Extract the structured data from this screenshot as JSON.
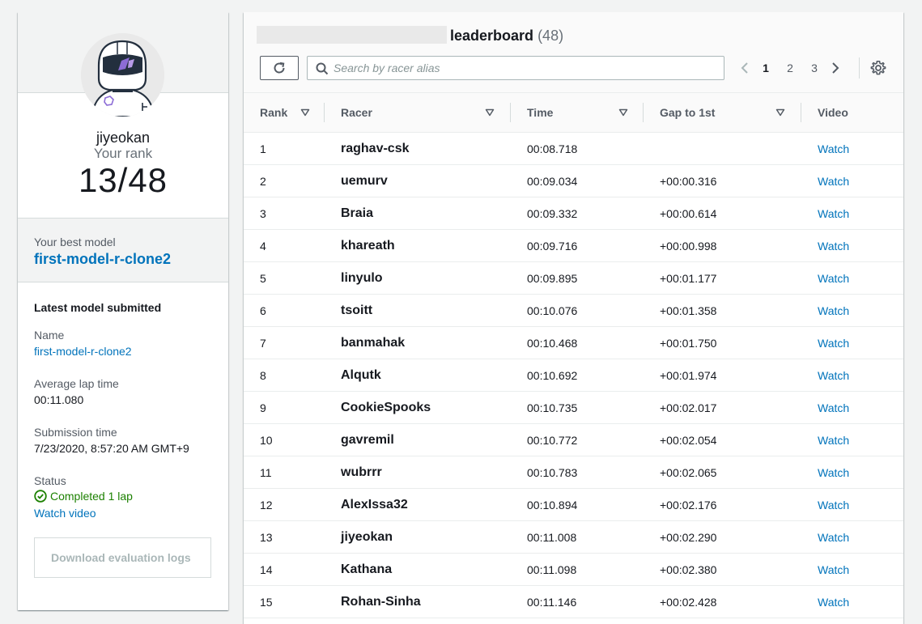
{
  "profile": {
    "username": "jiyeokan",
    "rank_label": "Your rank",
    "rank_value": "13/48",
    "best_model_label": "Your best model",
    "best_model_name": "first-model-r-clone2"
  },
  "latest": {
    "title": "Latest model submitted",
    "name_label": "Name",
    "name_value": "first-model-r-clone2",
    "avg_label": "Average lap time",
    "avg_value": "00:11.080",
    "submission_label": "Submission time",
    "submission_value": "7/23/2020, 8:57:20 AM GMT+9",
    "status_label": "Status",
    "status_value": "Completed 1 lap",
    "watch_video": "Watch video",
    "download_button": "Download evaluation logs"
  },
  "leaderboard": {
    "title": "leaderboard",
    "count": "(48)",
    "search_placeholder": "Search by racer alias",
    "pages": [
      "1",
      "2",
      "3"
    ],
    "active_page": "1",
    "columns": [
      "Rank",
      "Racer",
      "Time",
      "Gap to 1st",
      "Video"
    ],
    "rows": [
      {
        "rank": "1",
        "racer": "raghav-csk",
        "time": "00:08.718",
        "gap": "",
        "video": "Watch"
      },
      {
        "rank": "2",
        "racer": "uemurv",
        "time": "00:09.034",
        "gap": "+00:00.316",
        "video": "Watch"
      },
      {
        "rank": "3",
        "racer": "Braia",
        "time": "00:09.332",
        "gap": "+00:00.614",
        "video": "Watch"
      },
      {
        "rank": "4",
        "racer": "khareath",
        "time": "00:09.716",
        "gap": "+00:00.998",
        "video": "Watch"
      },
      {
        "rank": "5",
        "racer": "linyulo",
        "time": "00:09.895",
        "gap": "+00:01.177",
        "video": "Watch"
      },
      {
        "rank": "6",
        "racer": "tsoitt",
        "time": "00:10.076",
        "gap": "+00:01.358",
        "video": "Watch"
      },
      {
        "rank": "7",
        "racer": "banmahak",
        "time": "00:10.468",
        "gap": "+00:01.750",
        "video": "Watch"
      },
      {
        "rank": "8",
        "racer": "Alqutk",
        "time": "00:10.692",
        "gap": "+00:01.974",
        "video": "Watch"
      },
      {
        "rank": "9",
        "racer": "CookieSpooks",
        "time": "00:10.735",
        "gap": "+00:02.017",
        "video": "Watch"
      },
      {
        "rank": "10",
        "racer": "gavremil",
        "time": "00:10.772",
        "gap": "+00:02.054",
        "video": "Watch"
      },
      {
        "rank": "11",
        "racer": "wubrrr",
        "time": "00:10.783",
        "gap": "+00:02.065",
        "video": "Watch"
      },
      {
        "rank": "12",
        "racer": "AlexIssa32",
        "time": "00:10.894",
        "gap": "+00:02.176",
        "video": "Watch"
      },
      {
        "rank": "13",
        "racer": "jiyeokan",
        "time": "00:11.008",
        "gap": "+00:02.290",
        "video": "Watch"
      },
      {
        "rank": "14",
        "racer": "Kathana",
        "time": "00:11.098",
        "gap": "+00:02.380",
        "video": "Watch"
      },
      {
        "rank": "15",
        "racer": "Rohan-Sinha",
        "time": "00:11.146",
        "gap": "+00:02.428",
        "video": "Watch"
      }
    ]
  },
  "icons": {
    "refresh": "refresh-icon",
    "search": "search-icon",
    "prev": "chevron-left-icon",
    "next": "chevron-right-icon",
    "settings": "gear-icon",
    "sort": "caret-down-icon",
    "status": "check-circle-icon"
  },
  "colors": {
    "link": "#0073bb",
    "success": "#1d8102",
    "text": "#16191f",
    "muted": "#687078",
    "background": "#f2f3f3"
  }
}
